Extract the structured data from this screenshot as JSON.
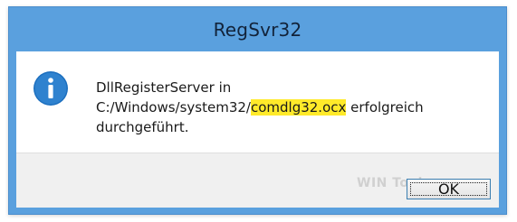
{
  "window": {
    "title": "RegSvr32"
  },
  "message": {
    "line1": "DllRegisterServer in",
    "line2_prefix": "C:/Windows/system32/",
    "line2_highlight": "comdlg32.ocx",
    "line2_suffix": " erfolgreich",
    "line3": "durchgeführt."
  },
  "icon": {
    "name": "info-icon",
    "color": "#1c6fbf",
    "glyph": "i"
  },
  "watermark": {
    "text": "WIN Tools"
  },
  "buttons": {
    "ok_label": "OK"
  },
  "colors": {
    "titlebar": "#5aa0de",
    "highlight": "#ffea2a",
    "footer": "#f0f0f0",
    "button_border": "#3c7fb1"
  }
}
